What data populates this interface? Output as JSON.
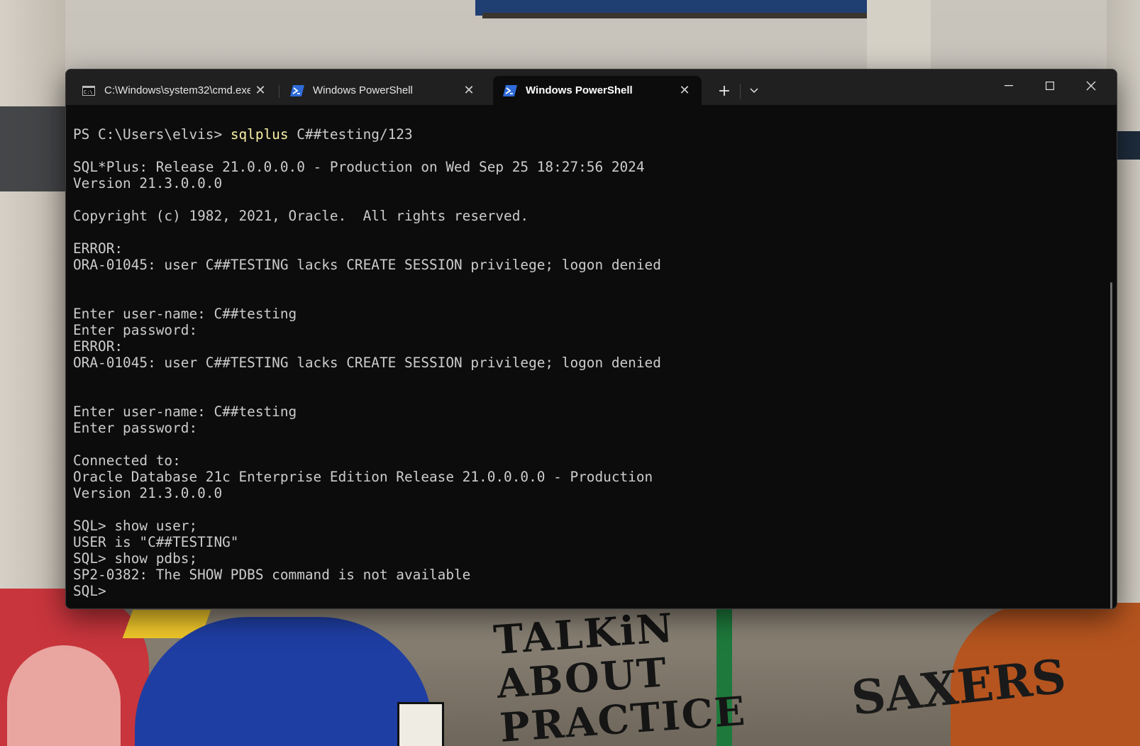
{
  "window": {
    "tabs": [
      {
        "title": "C:\\Windows\\system32\\cmd.exe",
        "icon": "cmd-icon",
        "active": false
      },
      {
        "title": "Windows PowerShell",
        "icon": "powershell-icon",
        "active": false
      },
      {
        "title": "Windows PowerShell",
        "icon": "powershell-icon",
        "active": true
      }
    ],
    "new_tab_symbol": "+",
    "dropdown_symbol": "⌄",
    "controls": {
      "minimize": "—",
      "maximize": "☐",
      "close": "✕"
    },
    "tab_close_symbol": "✕"
  },
  "terminal": {
    "prompt": "PS C:\\Users\\elvis> ",
    "command": "sqlplus",
    "command_args": " C##testing/123",
    "lines": [
      "",
      "SQL*Plus: Release 21.0.0.0.0 - Production on Wed Sep 25 18:27:56 2024",
      "Version 21.3.0.0.0",
      "",
      "Copyright (c) 1982, 2021, Oracle.  All rights reserved.",
      "",
      "ERROR:",
      "ORA-01045: user C##TESTING lacks CREATE SESSION privilege; logon denied",
      "",
      "",
      "Enter user-name: C##testing",
      "Enter password:",
      "ERROR:",
      "ORA-01045: user C##TESTING lacks CREATE SESSION privilege; logon denied",
      "",
      "",
      "Enter user-name: C##testing",
      "Enter password:",
      "",
      "Connected to:",
      "Oracle Database 21c Enterprise Edition Release 21.0.0.0.0 - Production",
      "Version 21.3.0.0.0",
      "",
      "SQL> show user;",
      "USER is \"C##TESTING\"",
      "SQL> show pdbs;",
      "SP2-0382: The SHOW PDBS command is not available",
      "SQL>"
    ]
  },
  "wallpaper": {
    "graffiti_text_1": "TALKiN ABOUT PRACTICE",
    "graffiti_text_2": "SAXERS"
  },
  "colors": {
    "terminal_bg": "#0c0c0c",
    "terminal_fg": "#cccccc",
    "command_highlight": "#f9f1a5",
    "titlebar_bg": "#202020",
    "powershell_icon": "#2f6bd8"
  }
}
